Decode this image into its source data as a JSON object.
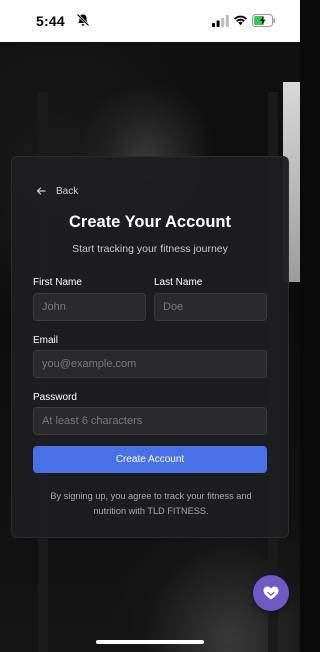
{
  "status_bar": {
    "time": "5:44"
  },
  "back": {
    "label": "Back"
  },
  "form": {
    "title": "Create Your Account",
    "subtitle": "Start tracking your fitness journey",
    "first_name": {
      "label": "First Name",
      "placeholder": "John",
      "value": ""
    },
    "last_name": {
      "label": "Last Name",
      "placeholder": "Doe",
      "value": ""
    },
    "email": {
      "label": "Email",
      "placeholder": "you@example.com",
      "value": ""
    },
    "password": {
      "label": "Password",
      "placeholder": "At least 6 characters",
      "value": ""
    },
    "submit_label": "Create Account",
    "terms": "By signing up, you agree to track your fitness and nutrition with TLD FITNESS."
  },
  "colors": {
    "accent": "#4a70e8",
    "fab": "#6d5ac7",
    "card_bg": "#1e1e20",
    "battery_charging": "#34c759"
  },
  "icons": [
    "bell-off-icon",
    "signal-icon",
    "wifi-icon",
    "battery-icon",
    "back-arrow-icon",
    "chat-heart-icon"
  ]
}
